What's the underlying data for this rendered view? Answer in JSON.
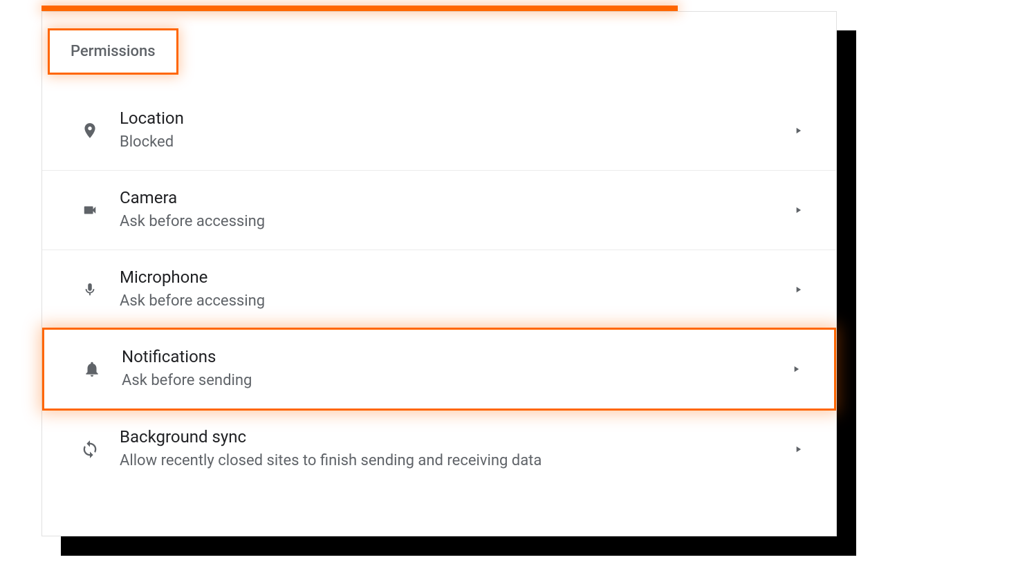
{
  "section": {
    "title": "Permissions"
  },
  "items": [
    {
      "icon": "location-icon",
      "title": "Location",
      "sub": "Blocked",
      "highlighted": false
    },
    {
      "icon": "camera-icon",
      "title": "Camera",
      "sub": "Ask before accessing",
      "highlighted": false
    },
    {
      "icon": "microphone-icon",
      "title": "Microphone",
      "sub": "Ask before accessing",
      "highlighted": false
    },
    {
      "icon": "bell-icon",
      "title": "Notifications",
      "sub": "Ask before sending",
      "highlighted": true
    },
    {
      "icon": "sync-icon",
      "title": "Background sync",
      "sub": "Allow recently closed sites to finish sending and receiving data",
      "highlighted": false
    }
  ],
  "colors": {
    "accent": "#ff6600",
    "text_primary": "#202124",
    "text_secondary": "#5f6368"
  }
}
